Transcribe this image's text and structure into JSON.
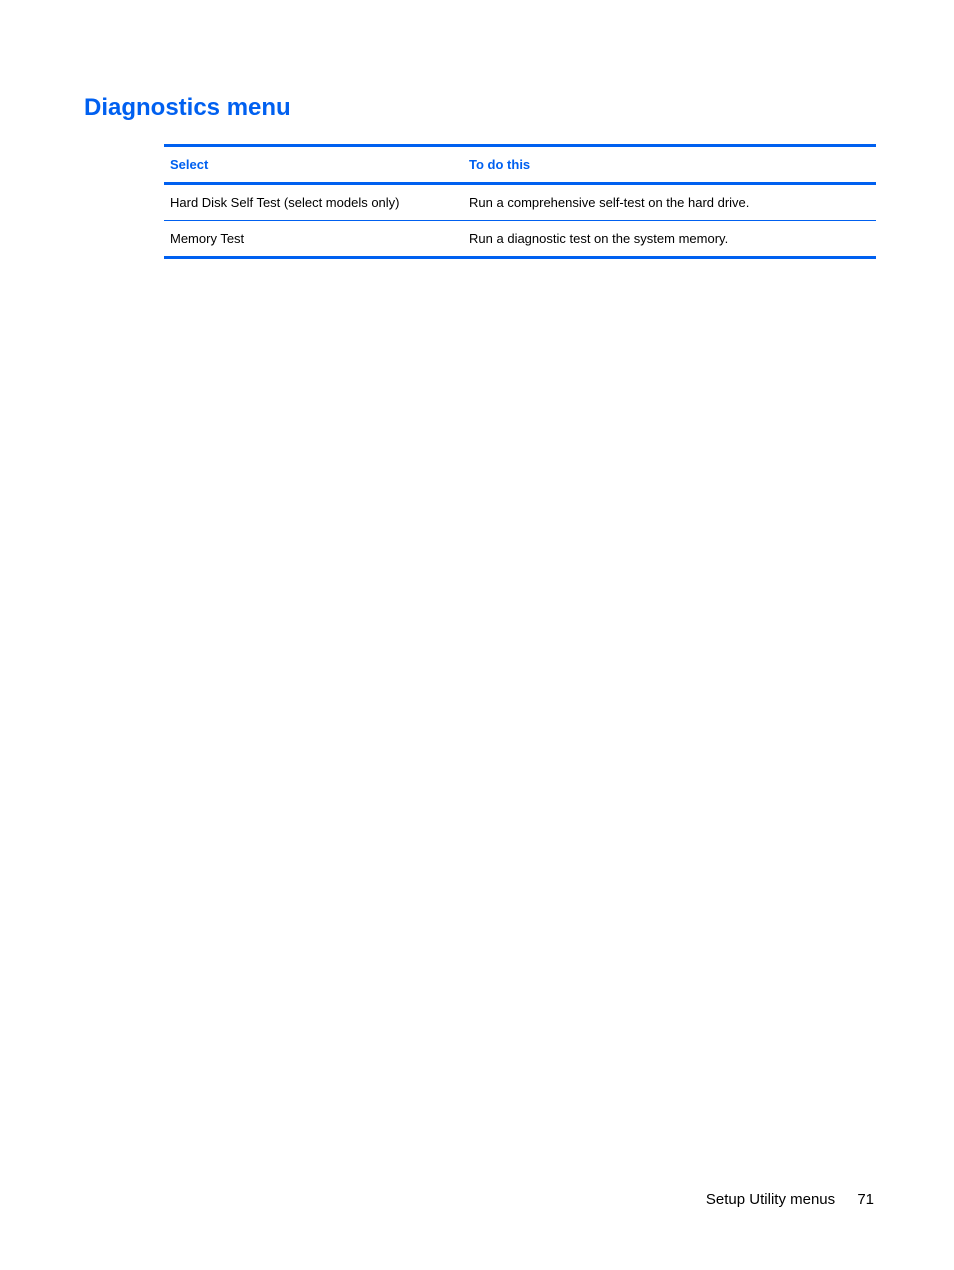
{
  "heading": "Diagnostics menu",
  "table": {
    "headers": {
      "col1": "Select",
      "col2": "To do this"
    },
    "rows": [
      {
        "select": "Hard Disk Self Test (select models only)",
        "todo": "Run a comprehensive self-test on the hard drive."
      },
      {
        "select": "Memory Test",
        "todo": "Run a diagnostic test on the system memory."
      }
    ]
  },
  "footer": {
    "section": "Setup Utility menus",
    "page": "71"
  }
}
